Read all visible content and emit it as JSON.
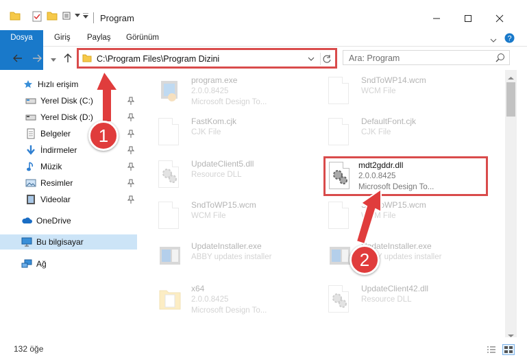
{
  "window": {
    "title": "Program",
    "minimize_icon": "minimize-icon",
    "maximize_icon": "maximize-icon",
    "close_icon": "close-icon"
  },
  "ribbon": {
    "tabs": [
      "Dosya",
      "Giriş",
      "Paylaş",
      "Görünüm"
    ],
    "expand_icon": "chevron-down-icon",
    "help_icon": "help-icon"
  },
  "address": {
    "path": "C:\\Program Files\\Program Dizini",
    "search_placeholder": "Ara: Program"
  },
  "sidebar": {
    "items": [
      {
        "label": "Hızlı erişim",
        "icon": "star-icon",
        "pinned": false
      },
      {
        "label": "Yerel Disk (C:)",
        "icon": "drive-icon",
        "pinned": true
      },
      {
        "label": "Yerel Disk (D:)",
        "icon": "drive-icon",
        "pinned": true
      },
      {
        "label": "Belgeler",
        "icon": "documents-icon",
        "pinned": true
      },
      {
        "label": "İndirmeler",
        "icon": "download-icon",
        "pinned": true
      },
      {
        "label": "Müzik",
        "icon": "music-icon",
        "pinned": true
      },
      {
        "label": "Resimler",
        "icon": "pictures-icon",
        "pinned": true
      },
      {
        "label": "Videolar",
        "icon": "video-icon",
        "pinned": true
      },
      {
        "label": "OneDrive",
        "icon": "cloud-icon",
        "pinned": false
      },
      {
        "label": "Bu bilgisayar",
        "icon": "computer-icon",
        "pinned": false,
        "selected": true
      },
      {
        "label": "Ağ",
        "icon": "network-icon",
        "pinned": false
      }
    ]
  },
  "files": [
    {
      "name": "program.exe",
      "line2": "2.0.0.8425",
      "line3": "Microsoft Design To...",
      "icon": "exe-icon",
      "faded": true
    },
    {
      "name": "SndToWP14.wcm",
      "line2": "WCM File",
      "line3": "",
      "icon": "document-icon",
      "faded": true
    },
    {
      "name": "FastKom.cjk",
      "line2": "CJK File",
      "line3": "",
      "icon": "document-icon",
      "faded": true
    },
    {
      "name": "DefaultFont.cjk",
      "line2": "CJK File",
      "line3": "",
      "icon": "document-icon",
      "faded": true
    },
    {
      "name": "UpdateClient5.dll",
      "line2": "Resource DLL",
      "line3": "",
      "icon": "dll-gear-icon",
      "faded": true
    },
    {
      "name": "mdt2gddr.dll",
      "line2": "2.0.0.8425",
      "line3": "Microsoft Design To...",
      "icon": "dll-gear-icon",
      "faded": false,
      "highlighted": true
    },
    {
      "name": "SndToWP15.wcm",
      "line2": "WCM File",
      "line3": "",
      "icon": "document-icon",
      "faded": true
    },
    {
      "name": "SndToWP15.wcm",
      "line2": "WCM File",
      "line3": "",
      "icon": "document-icon",
      "faded": true
    },
    {
      "name": "UpdateInstaller.exe",
      "line2": "ABBY updates installer",
      "line3": "",
      "icon": "installer-icon",
      "faded": true
    },
    {
      "name": "UpdateInstaller.exe",
      "line2": "ABBY updates installer",
      "line3": "",
      "icon": "installer-icon",
      "faded": true
    },
    {
      "name": "x64",
      "line2": "2.0.0.8425",
      "line3": "Microsoft Design To...",
      "icon": "folder-icon",
      "faded": true
    },
    {
      "name": "UpdateClient42.dll",
      "line2": "Resource DLL",
      "line3": "",
      "icon": "dll-gear-icon",
      "faded": true
    }
  ],
  "status": {
    "count": "132 öğe",
    "details_view_icon": "details-view-icon",
    "tiles_view_icon": "tiles-view-icon"
  },
  "annotations": [
    "1",
    "2"
  ],
  "colors": {
    "accent": "#1979ca",
    "highlight_border": "#d94b4b",
    "badge": "#e03c3c",
    "selected": "#cce4f7"
  }
}
